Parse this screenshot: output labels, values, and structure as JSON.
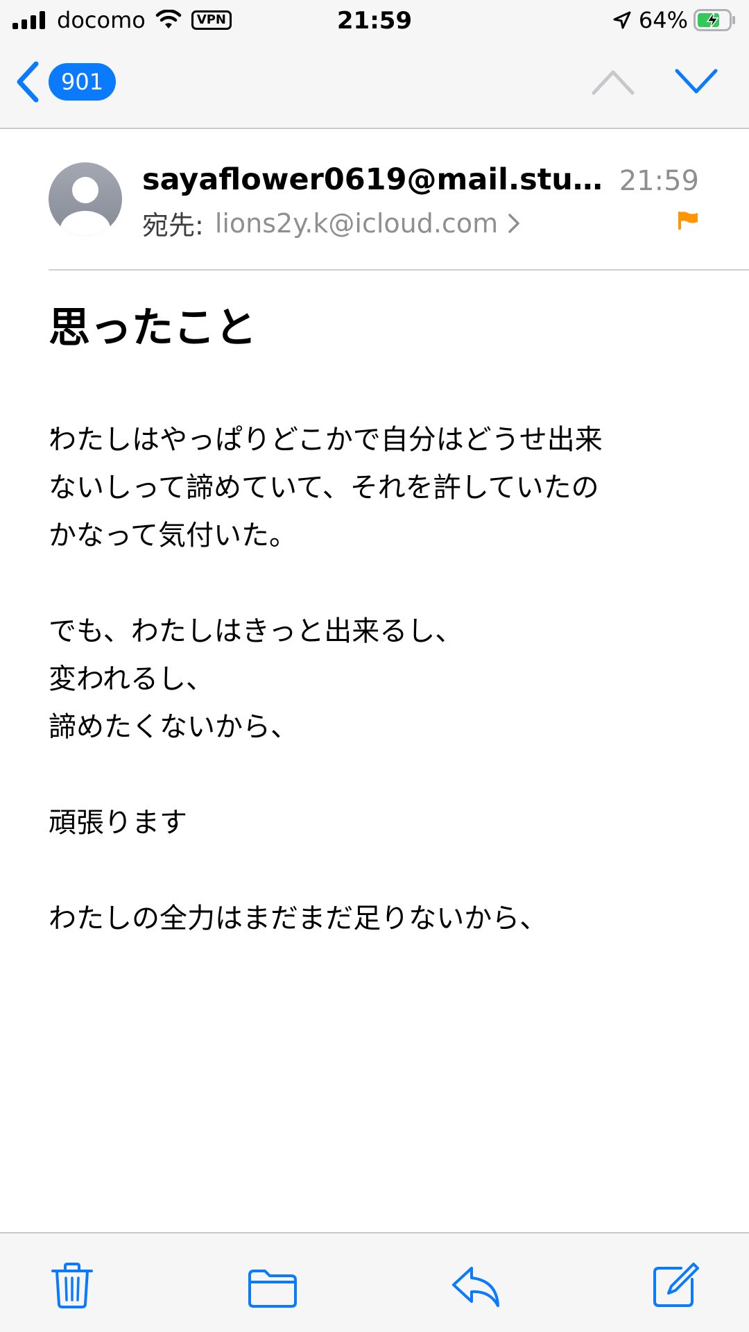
{
  "status_bar": {
    "carrier": "docomo",
    "vpn": "VPN",
    "time": "21:59",
    "battery": "64%",
    "icons": [
      "signal-icon",
      "wifi-icon",
      "location-arrow-icon",
      "battery-charging-icon"
    ]
  },
  "nav": {
    "back_count": "901",
    "icons": [
      "chevron-left-icon",
      "chevron-up-icon",
      "chevron-down-icon"
    ]
  },
  "email": {
    "sender": "sayaflower0619@mail.stu4...",
    "time": "21:59",
    "to_label": "宛先:",
    "to_address": "lions2y.k@icloud.com",
    "subject": "思ったこと",
    "body_dot": ".",
    "body_lines": [
      "わたしはやっぱりどこかで自分はどうせ出来",
      "ないしって諦めていて、それを許していたの",
      "かなって気付いた。",
      "",
      "でも、わたしはきっと出来るし、",
      "変われるし、",
      "諦めたくないから、",
      "",
      "頑張ります",
      "",
      "わたしの全力はまだまだ足りないから、"
    ],
    "flag_color": "#ff9500"
  },
  "toolbar": {
    "icons": [
      "trash-icon",
      "folder-icon",
      "reply-icon",
      "compose-icon"
    ],
    "accent": "#0a7aff"
  }
}
